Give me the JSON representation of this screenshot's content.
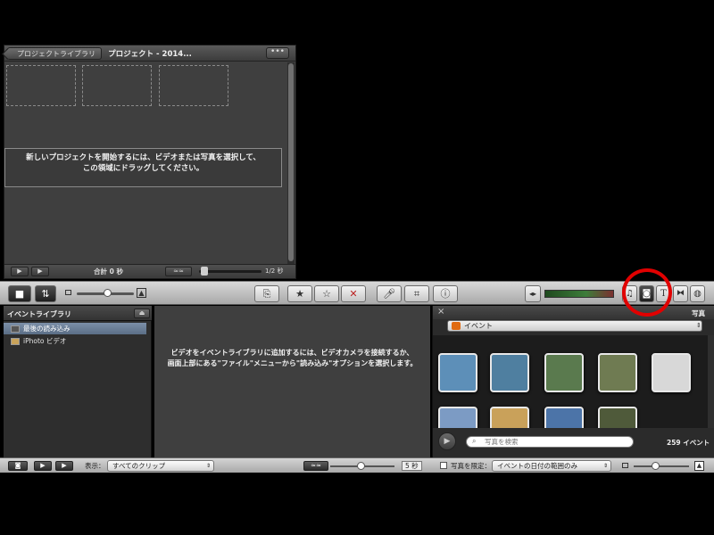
{
  "project": {
    "library_button": "プロジェクトライブラリ",
    "title": "プロジェクト - 2014...",
    "more_button": "•••",
    "drop_message_line1": "新しいプロジェクトを開始するには、ビデオまたは写真を選択して、",
    "drop_message_line2": "この領域にドラッグしてください。",
    "total_label": "合計 0 秒",
    "zoom_label": "1/2 秒"
  },
  "event_library": {
    "title": "イベントライブラリ",
    "items": [
      {
        "label": "最後の読み込み",
        "selected": true
      },
      {
        "label": "iPhoto ビデオ",
        "selected": false
      }
    ]
  },
  "event_browser": {
    "message_line1": "ビデオをイベントライブラリに追加するには、ビデオカメラを接続するか、",
    "message_line2": "画面上部にある\"ファイル\"メニューから\"読み込み\"オプションを選択します。"
  },
  "photo_browser": {
    "title": "写真",
    "close": "×",
    "source": "イベント",
    "search_placeholder": "写真を検索",
    "count": "259 イベント",
    "photos": [
      {
        "icon": "photo-thumbnail",
        "color": "#5d8fb8"
      },
      {
        "icon": "photo-thumbnail",
        "color": "#4f7fa0"
      },
      {
        "icon": "photo-thumbnail",
        "color": "#5a7a4e"
      },
      {
        "icon": "photo-thumbnail",
        "color": "#6f7b52"
      },
      {
        "icon": "photo-thumbnail",
        "color": "#d8d8d8"
      },
      {
        "icon": "photo-thumbnail",
        "color": "#7c9bc4"
      },
      {
        "icon": "photo-thumbnail",
        "color": "#c9a15a"
      },
      {
        "icon": "photo-thumbnail",
        "color": "#4c74a8"
      },
      {
        "icon": "photo-thumbnail",
        "color": "#4f5a3a"
      }
    ]
  },
  "bottom_bar": {
    "view_label": "表示：",
    "view_select": "すべてのクリップ",
    "duration_label": "5 秒",
    "filter_label": "写真を限定：",
    "filter_select": "イベントの日付の範囲のみ"
  },
  "colors": {
    "highlight": "#e10000",
    "selection": "#6b7e96"
  }
}
